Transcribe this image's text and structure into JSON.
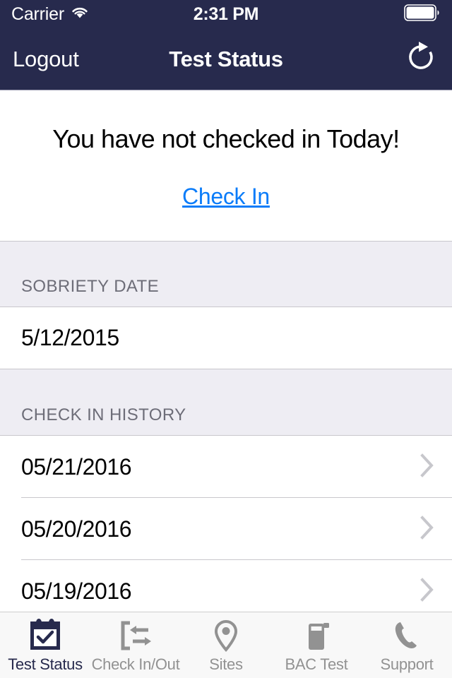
{
  "status_bar": {
    "carrier": "Carrier",
    "wifi_icon": "wifi-icon",
    "time": "2:31 PM",
    "battery_icon": "battery-full-icon"
  },
  "nav_bar": {
    "logout_label": "Logout",
    "title": "Test Status",
    "refresh_icon": "refresh-icon"
  },
  "status_panel": {
    "message": "You have not checked in Today!",
    "check_in_label": "Check In"
  },
  "sobriety_section": {
    "header": "SOBRIETY DATE",
    "value": "5/12/2015"
  },
  "history_section": {
    "header": "CHECK IN HISTORY",
    "rows": [
      {
        "date": "05/21/2016",
        "chevron_icon": "chevron-right-icon"
      },
      {
        "date": "05/20/2016",
        "chevron_icon": "chevron-right-icon"
      },
      {
        "date": "05/19/2016",
        "chevron_icon": "chevron-right-icon"
      }
    ]
  },
  "tab_bar": {
    "items": [
      {
        "label": "Test Status",
        "icon": "calendar-check-icon",
        "active": true
      },
      {
        "label": "Check In/Out",
        "icon": "check-in-out-icon",
        "active": false
      },
      {
        "label": "Sites",
        "icon": "map-pin-icon",
        "active": false
      },
      {
        "label": "BAC Test",
        "icon": "breathalyzer-icon",
        "active": false
      },
      {
        "label": "Support",
        "icon": "phone-icon",
        "active": false
      }
    ]
  },
  "colors": {
    "navy": "#272a4d",
    "link_blue": "#0a7cf9",
    "group_background": "#eeedf3",
    "separator": "#c8c7cc",
    "inactive_tab": "#929292"
  }
}
